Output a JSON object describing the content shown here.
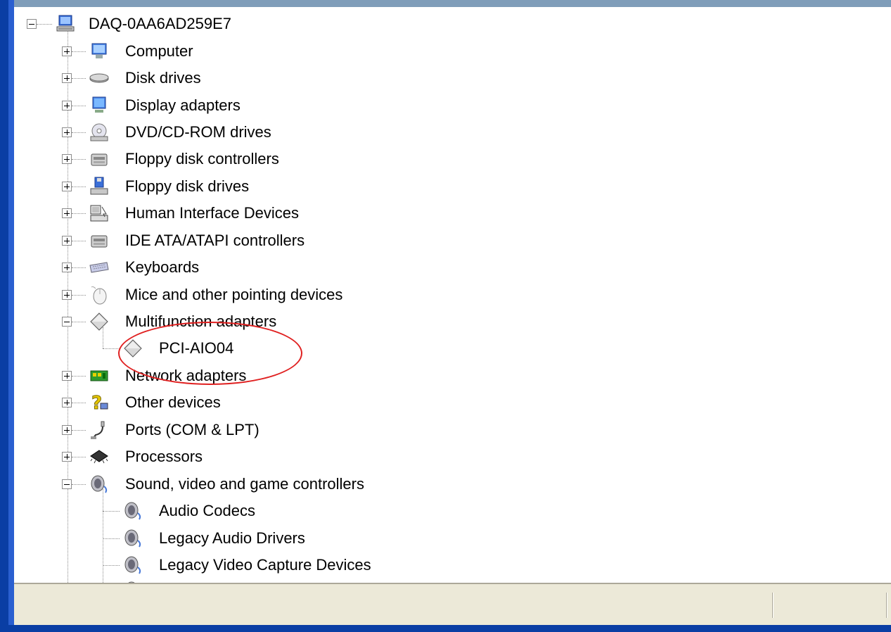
{
  "root": {
    "label": "DAQ-0AA6AD259E7",
    "icon": "computer-network-icon",
    "expanded": true
  },
  "categories": [
    {
      "label": "Computer",
      "icon": "computer-icon",
      "expanded": false
    },
    {
      "label": "Disk drives",
      "icon": "disk-drive-icon",
      "expanded": false
    },
    {
      "label": "Display adapters",
      "icon": "display-adapter-icon",
      "expanded": false
    },
    {
      "label": "DVD/CD-ROM drives",
      "icon": "cdrom-icon",
      "expanded": false
    },
    {
      "label": "Floppy disk controllers",
      "icon": "controller-icon",
      "expanded": false
    },
    {
      "label": "Floppy disk drives",
      "icon": "floppy-drive-icon",
      "expanded": false
    },
    {
      "label": "Human Interface Devices",
      "icon": "hid-icon",
      "expanded": false
    },
    {
      "label": "IDE ATA/ATAPI controllers",
      "icon": "controller-icon",
      "expanded": false
    },
    {
      "label": "Keyboards",
      "icon": "keyboard-icon",
      "expanded": false
    },
    {
      "label": "Mice and other pointing devices",
      "icon": "mouse-icon",
      "expanded": false
    },
    {
      "label": "Multifunction adapters",
      "icon": "multifunction-icon",
      "expanded": true,
      "children": [
        {
          "label": "PCI-AIO04",
          "icon": "multifunction-icon"
        }
      ]
    },
    {
      "label": "Network adapters",
      "icon": "network-adapter-icon",
      "expanded": false
    },
    {
      "label": "Other devices",
      "icon": "unknown-device-icon",
      "expanded": false
    },
    {
      "label": "Ports (COM & LPT)",
      "icon": "port-icon",
      "expanded": false
    },
    {
      "label": "Processors",
      "icon": "processor-icon",
      "expanded": false
    },
    {
      "label": "Sound, video and game controllers",
      "icon": "sound-icon",
      "expanded": true,
      "children": [
        {
          "label": "Audio Codecs",
          "icon": "sound-icon"
        },
        {
          "label": "Legacy Audio Drivers",
          "icon": "sound-icon"
        },
        {
          "label": "Legacy Video Capture Devices",
          "icon": "sound-icon"
        }
      ]
    }
  ],
  "colors": {
    "frame_blue": "#0a3ea4",
    "status_bg": "#ece9d8",
    "annotation_red": "#e02020"
  }
}
